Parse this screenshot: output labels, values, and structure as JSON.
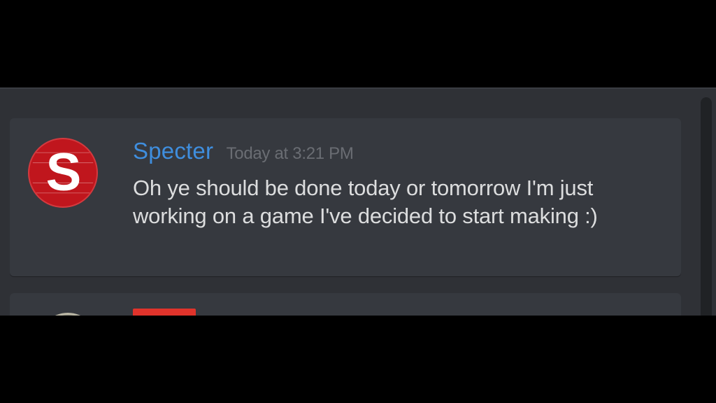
{
  "messages": [
    {
      "author": "Specter",
      "timestamp": "Today at 3:21 PM",
      "avatar_letter": "S",
      "content": "Oh ye should be done today or tomorrow I'm just working on a game I've decided to start making :)"
    }
  ],
  "colors": {
    "background": "#2f3136",
    "card": "#36393f",
    "username": "#3f8ede",
    "timestamp": "#6a6d73",
    "text": "#dcddde",
    "avatar": "#c0161d",
    "next_username": "#e0332b"
  },
  "icons": {
    "avatar": "red-circle-s-logo"
  }
}
